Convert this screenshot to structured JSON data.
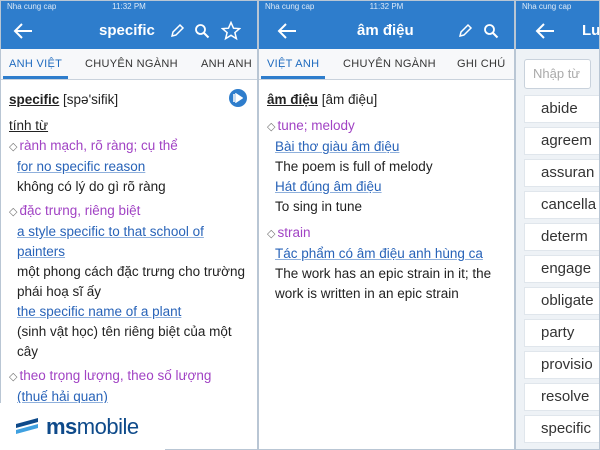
{
  "colors": {
    "accent": "#2e7dcc",
    "sense": "#a143c4",
    "example": "#2863b8",
    "logo": "#0e4a8a"
  },
  "screen1": {
    "status": {
      "carrier": "Nha cung cap",
      "time": "11:32 PM"
    },
    "title": "specific",
    "icons": [
      "back-arrow-icon",
      "pencil-icon",
      "search-icon",
      "star-icon"
    ],
    "tabs": [
      "ANH VIỆT",
      "CHUYÊN NGÀNH",
      "ANH ANH"
    ],
    "headword": "specific",
    "pron": "[spə'sifik]",
    "pos": "tính từ",
    "senses": [
      {
        "sense": "rành mạch, rõ ràng; cụ thể",
        "examples": [
          {
            "en": "for no specific reason",
            "vi": "không có lý do gì rõ ràng"
          }
        ]
      },
      {
        "sense": "đặc trưng, riêng biệt",
        "examples": [
          {
            "en": "a style specific to that school of painters",
            "vi": "một phong cách đặc trưng cho trường phái hoạ sĩ ấy"
          },
          {
            "en": "the specific name of a plant",
            "vi": "(sinh vật học) tên riêng biệt của một cây"
          }
        ]
      },
      {
        "sense": "theo trọng lượng, theo số lượng",
        "examples": [
          {
            "en": "(thuế hải quan)",
            "vi": ""
          }
        ]
      }
    ]
  },
  "screen2": {
    "status": {
      "carrier": "Nha cung cap",
      "time": "11:32 PM"
    },
    "title": "âm điệu",
    "icons": [
      "back-arrow-icon",
      "pencil-icon",
      "search-icon"
    ],
    "tabs": [
      "VIỆT ANH",
      "CHUYÊN NGÀNH",
      "GHI CHÚ"
    ],
    "headword": "âm điệu",
    "pron": "[âm điệu]",
    "senses": [
      {
        "sense": "tune; melody",
        "examples": [
          {
            "vi": "Bài thơ giàu âm điệu",
            "en": "The poem is full of melody"
          },
          {
            "vi": "Hát đúng âm điệu",
            "en": "To sing in tune"
          }
        ]
      },
      {
        "sense": "strain",
        "examples": [
          {
            "vi": "Tác phẩm có âm điệu anh hùng ca",
            "en": "The work has an epic strain in it; the work is written in an epic strain"
          }
        ]
      }
    ]
  },
  "screen3": {
    "status": {
      "carrier": "Nha cung cap"
    },
    "title": "Lu",
    "search_placeholder": "Nhập từ",
    "words": [
      "abide",
      "agreem",
      "assuran",
      "cancella",
      "determ",
      "engage",
      "obligate",
      "party",
      "provisio",
      "resolve",
      "specific"
    ]
  },
  "logo": {
    "ms": "ms",
    "mobile": "mobile"
  }
}
